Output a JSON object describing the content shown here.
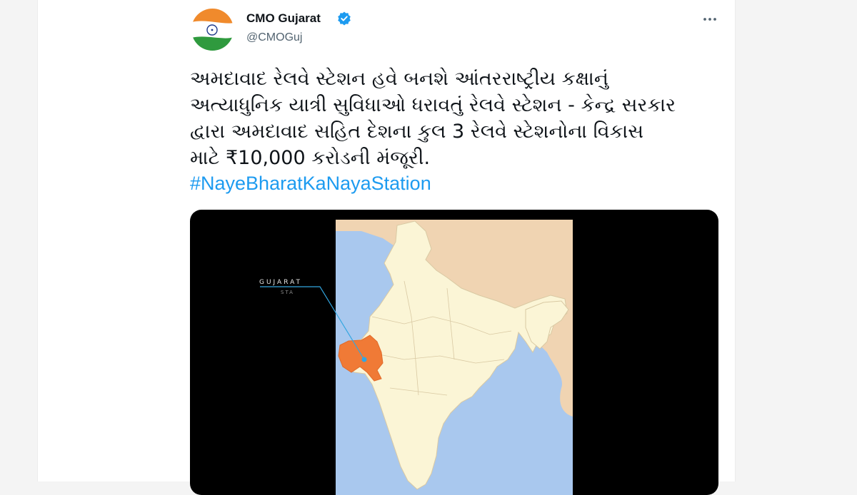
{
  "tweet": {
    "author_name": "CMO Gujarat",
    "author_handle": "@CMOGuj",
    "text": "અમદાવાદ રેલવે સ્ટેશન હવે બનશે આંતરરાષ્ટ્રીય કક્ષાનું\nઅત્યાધુનિક યાત્રી સુવિધાઓ ધરાવતું રેલવે સ્ટેશન - કેન્દ્ર સરકાર\nદ્વારા અમદાવાદ સહિત દેશના કુલ 3 રેલવે સ્ટેશનોના વિકાસ\nમાટે ₹10,000 કરોડની મંજૂરી.",
    "hashtag": "#NayeBharatKaNayaStation"
  },
  "icons": {
    "avatar": "india-flag-avatar",
    "verified": "verified-badge-icon",
    "more": "more-options-icon"
  },
  "media": {
    "map_label": "GUJARAT",
    "map_sublabel": "STA"
  },
  "colors": {
    "accent": "#1d9bf0",
    "map_land": "#fbf5d6",
    "map_neighbors": "#f0d4b2",
    "map_sea": "#a9c8ee",
    "gujarat_highlight": "#f07a36"
  }
}
